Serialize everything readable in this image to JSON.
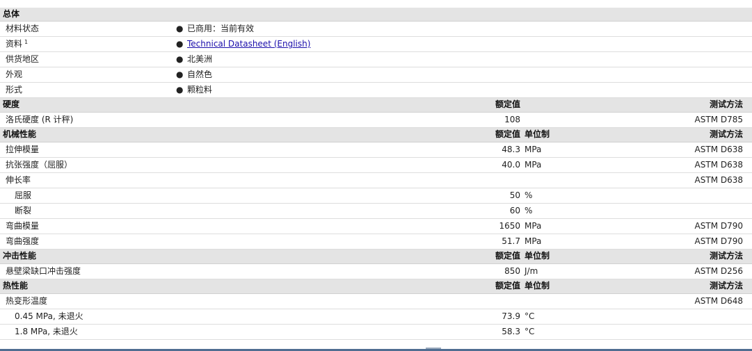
{
  "general": {
    "title": "总体",
    "rows": [
      {
        "label": "材料状态",
        "value": "已商用：当前有效",
        "link": false
      },
      {
        "label": "资料",
        "sup": "1",
        "value": "Technical Datasheet (English)",
        "link": true
      },
      {
        "label": "供货地区",
        "value": "北美洲",
        "link": false
      },
      {
        "label": "外观",
        "value": "自然色",
        "link": false
      },
      {
        "label": "形式",
        "value": "颗粒料",
        "link": false
      }
    ],
    "bullet": "●"
  },
  "hardness": {
    "title": "硬度",
    "col_nominal": "额定值",
    "col_method": "测试方法",
    "rows": [
      {
        "label": "洛氏硬度 (R 计秤)",
        "value": "108",
        "unit": "",
        "method": "ASTM D785"
      }
    ]
  },
  "mechanical": {
    "title": "机械性能",
    "col_nominal": "额定值",
    "col_unit": "单位制",
    "col_method": "测试方法",
    "rows": [
      {
        "label": "拉伸模量",
        "value": "48.3",
        "unit": "MPa",
        "method": "ASTM D638",
        "indent": false
      },
      {
        "label": "抗张强度（屈服）",
        "value": "40.0",
        "unit": "MPa",
        "method": "ASTM D638",
        "indent": false
      },
      {
        "label": "伸长率",
        "value": "",
        "unit": "",
        "method": "ASTM D638",
        "indent": false
      },
      {
        "label": "屈服",
        "value": "50",
        "unit": "%",
        "method": "",
        "indent": true
      },
      {
        "label": "断裂",
        "value": "60",
        "unit": "%",
        "method": "",
        "indent": true
      },
      {
        "label": "弯曲模量",
        "value": "1650",
        "unit": "MPa",
        "method": "ASTM D790",
        "indent": false
      },
      {
        "label": "弯曲强度",
        "value": "51.7",
        "unit": "MPa",
        "method": "ASTM D790",
        "indent": false
      }
    ]
  },
  "impact": {
    "title": "冲击性能",
    "col_nominal": "额定值",
    "col_unit": "单位制",
    "col_method": "测试方法",
    "rows": [
      {
        "label": "悬壁梁缺口冲击强度",
        "value": "850",
        "unit": "J/m",
        "method": "ASTM D256",
        "indent": false
      }
    ]
  },
  "thermal": {
    "title": "热性能",
    "col_nominal": "额定值",
    "col_unit": "单位制",
    "col_method": "测试方法",
    "rows": [
      {
        "label": "热变形温度",
        "value": "",
        "unit": "",
        "method": "ASTM D648",
        "indent": false
      },
      {
        "label": "0.45 MPa, 未退火",
        "value": "73.9",
        "unit": "°C",
        "method": "",
        "indent": true
      },
      {
        "label": "1.8 MPa, 未退火",
        "value": "58.3",
        "unit": "°C",
        "method": "",
        "indent": true
      }
    ]
  }
}
